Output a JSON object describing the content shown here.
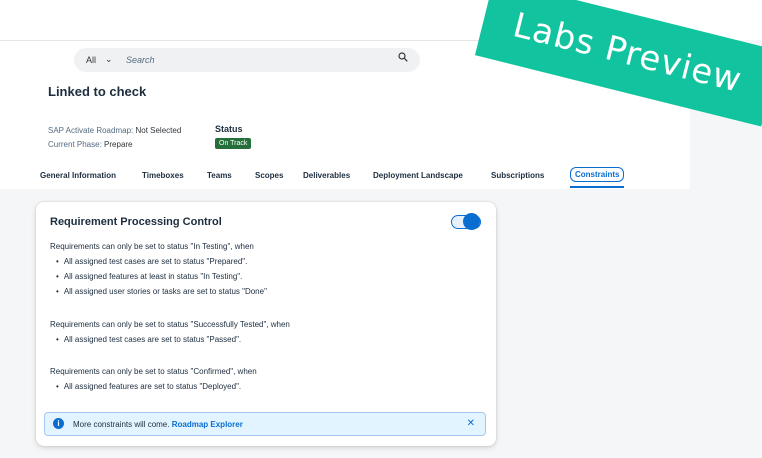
{
  "search": {
    "scope": "All",
    "placeholder": "Search"
  },
  "project": {
    "title": "Linked to check",
    "roadmap_label": "SAP Activate Roadmap:",
    "roadmap_value": "Not Selected",
    "phase_label": "Current Phase:",
    "phase_value": "Prepare",
    "status_label": "Status",
    "status_value": "On Track"
  },
  "tabs": [
    "General Information",
    "Timeboxes",
    "Teams",
    "Scopes",
    "Deliverables",
    "Deployment Landscape",
    "Subscriptions",
    "Constraints"
  ],
  "card": {
    "title": "Requirement Processing Control",
    "toggle_on": true,
    "p1": "Requirements can only be set to status \"In Testing\", when",
    "b1": [
      "All assigned test cases are set to status \"Prepared\".",
      "All assigned features at least in status \"In Testing\".",
      "All assigned user stories or tasks are set to status \"Done\""
    ],
    "p2": "Requirements can only be set to status \"Successfully Tested\", when",
    "b2": [
      "All assigned test cases are set to status \"Passed\"."
    ],
    "p3": "Requirements can only be set to status \"Confirmed\", when",
    "b3": [
      "All assigned features are set to status \"Deployed\"."
    ]
  },
  "info": {
    "text": "More constraints will come.",
    "link": "Roadmap Explorer"
  },
  "ribbon": {
    "text": "Labs Preview"
  },
  "colors": {
    "accent": "#0a6ed1",
    "ribbon": "#11c49f",
    "status_green": "#256f3a"
  },
  "icons": [
    "chevron-down-icon",
    "search-icon",
    "info-icon",
    "close-icon"
  ]
}
